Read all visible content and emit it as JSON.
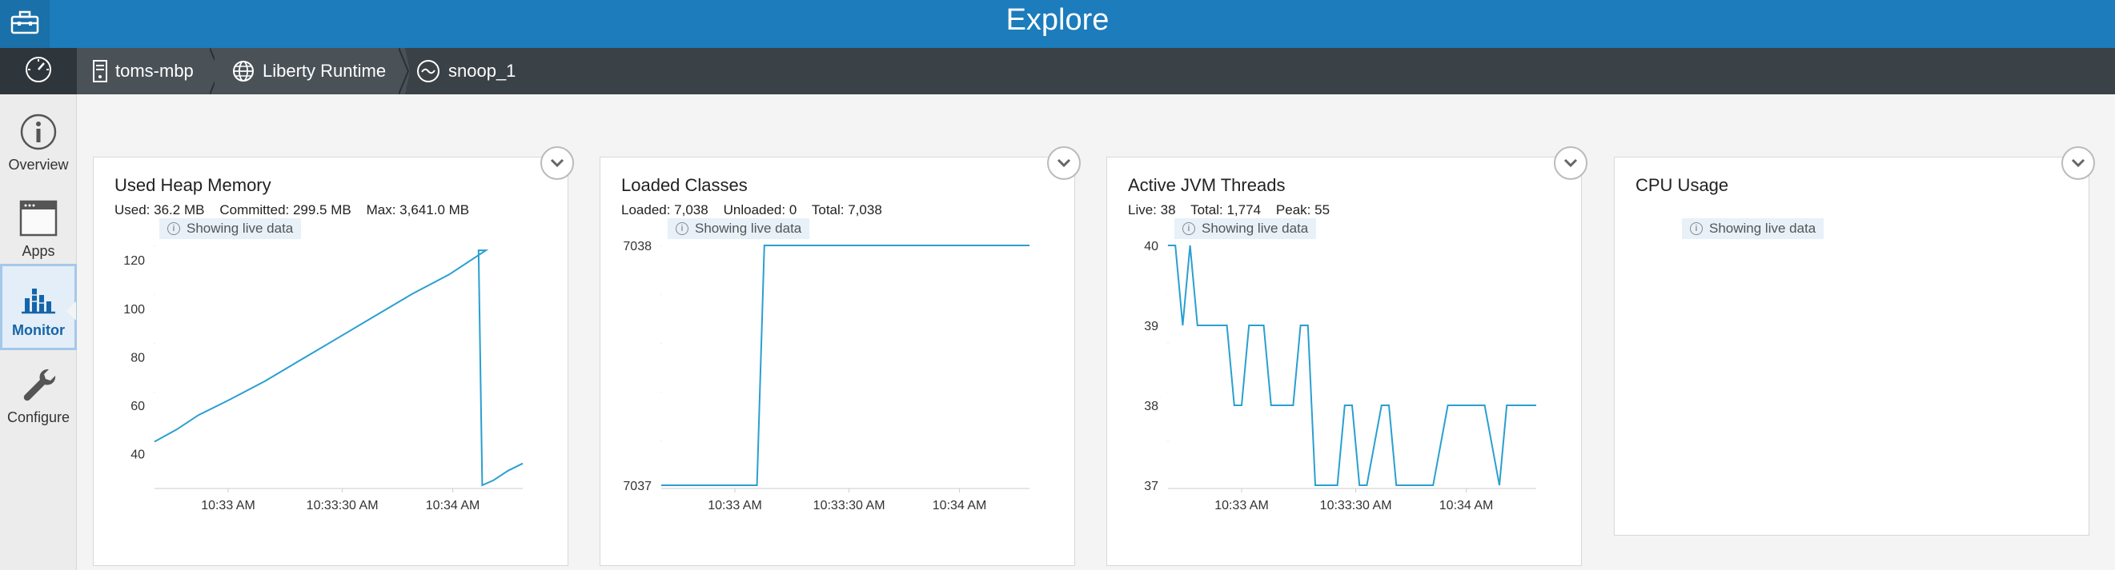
{
  "header": {
    "title": "Explore"
  },
  "breadcrumb": {
    "host": "toms-mbp",
    "runtime": "Liberty Runtime",
    "server": "snoop_1"
  },
  "sidebar": {
    "items": [
      {
        "label": "Overview"
      },
      {
        "label": "Apps"
      },
      {
        "label": "Monitor"
      },
      {
        "label": "Configure"
      }
    ]
  },
  "live_label": "Showing live data",
  "colors": {
    "accent": "#1c7cbc",
    "line": "#2a9fd0"
  },
  "cards": {
    "heap": {
      "title": "Used Heap Memory",
      "stats": "Used: 36.2 MB    Committed: 299.5 MB    Max: 3,641.0 MB"
    },
    "classes": {
      "title": "Loaded Classes",
      "stats": "Loaded: 7,038    Unloaded: 0    Total: 7,038"
    },
    "threads": {
      "title": "Active JVM Threads",
      "stats": "Live: 38    Total: 1,774    Peak: 55"
    },
    "cpu": {
      "title": "CPU Usage"
    }
  },
  "chart_data": [
    {
      "type": "line",
      "title": "Used Heap Memory",
      "x_ticks": [
        "10:33 AM",
        "10:33:30 AM",
        "10:34 AM"
      ],
      "y_ticks": [
        40,
        60,
        80,
        100,
        120
      ],
      "ylim": [
        27,
        126
      ],
      "x": [
        0,
        0.06,
        0.12,
        0.2,
        0.3,
        0.4,
        0.5,
        0.6,
        0.7,
        0.8,
        0.9,
        0.88,
        0.89,
        0.92,
        0.96,
        1.0
      ],
      "y": [
        45,
        50,
        56,
        62,
        70,
        79,
        88,
        97,
        106,
        114,
        124,
        124,
        27,
        29,
        33,
        36
      ],
      "series": [
        {
          "name": "Used Heap Memory"
        }
      ]
    },
    {
      "type": "line",
      "title": "Loaded Classes",
      "x_ticks": [
        "10:33 AM",
        "10:33:30 AM",
        "10:34 AM"
      ],
      "y_ticks": [
        7037,
        7038
      ],
      "ylim": [
        7037,
        7038
      ],
      "x": [
        0,
        0.26,
        0.28,
        1.0
      ],
      "y": [
        7037,
        7037,
        7038,
        7038
      ]
    },
    {
      "type": "line",
      "title": "Active JVM Threads",
      "x_ticks": [
        "10:33 AM",
        "10:33:30 AM",
        "10:34 AM"
      ],
      "y_ticks": [
        37,
        38,
        39,
        40
      ],
      "ylim": [
        37,
        40
      ],
      "x": [
        0,
        0.02,
        0.04,
        0.06,
        0.08,
        0.12,
        0.16,
        0.18,
        0.2,
        0.22,
        0.26,
        0.28,
        0.3,
        0.34,
        0.36,
        0.38,
        0.4,
        0.42,
        0.46,
        0.48,
        0.5,
        0.52,
        0.54,
        0.58,
        0.6,
        0.62,
        0.66,
        0.7,
        0.72,
        0.76,
        0.78,
        0.82,
        0.86,
        0.9,
        0.92,
        0.94,
        1.0
      ],
      "y": [
        40,
        40,
        39,
        40,
        39,
        39,
        39,
        38,
        38,
        39,
        39,
        38,
        38,
        38,
        39,
        39,
        37,
        37,
        37,
        38,
        38,
        37,
        37,
        38,
        38,
        37,
        37,
        37,
        37,
        38,
        38,
        38,
        38,
        37,
        38,
        38,
        38
      ]
    },
    {
      "type": "line",
      "title": "CPU Usage",
      "x": [],
      "y": []
    }
  ]
}
